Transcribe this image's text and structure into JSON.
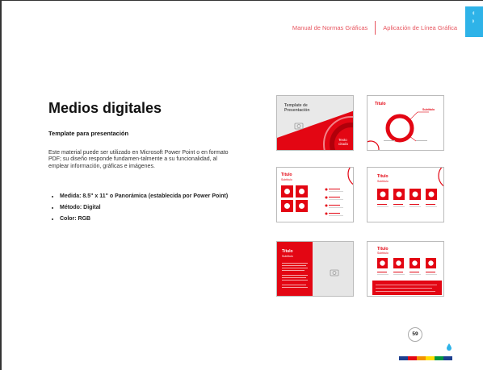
{
  "header": {
    "manual_title": "Manual de Normas Gráficas",
    "section_title": "Aplicación de Línea Gráfica"
  },
  "page": {
    "title": "Medios digitales",
    "subtitle": "Template para presentación",
    "body": "Este material puede ser utilizado en Microsoft Power Point o en formato PDF; su diseño responde fundamen-talmente a su funcionalidad, al emplear información, gráficas e imágenes.",
    "bullets": [
      "Medida: 8.5\" x 11\" o Panorámica (establecida por Power Point)",
      "Método: Digital",
      "Color: RGB"
    ],
    "page_number": "59"
  },
  "thumbnails": {
    "t1_title": "Template de Presentación",
    "t1_quote": "Texto citado",
    "t2_title": "Título",
    "t2_sub": "Subtítulo",
    "t3_title": "Título",
    "t3_sub": "Subtítulo",
    "t4_title": "Título",
    "t4_sub": "Subtítulo",
    "t5_title": "Título",
    "t5_sub": "Subtítulo",
    "t6_title": "Título",
    "t6_sub": "Subtítulo"
  },
  "colors": {
    "brand_red": "#e30613",
    "accent_pink": "#e7545e",
    "tab_blue": "#2eb3e8",
    "strip": [
      "#1d3f8f",
      "#e30613",
      "#f39200",
      "#ffdd00",
      "#009640",
      "#1d3f8f"
    ]
  },
  "icons": [
    "camera-icon",
    "water-drop-icon"
  ]
}
